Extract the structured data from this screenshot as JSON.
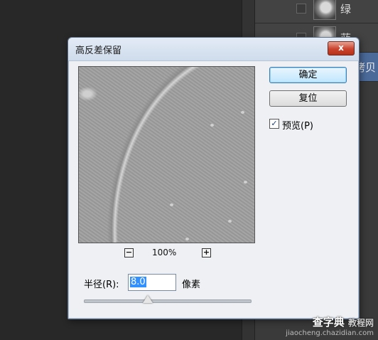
{
  "layers_panel": {
    "layers": [
      {
        "name": "绿",
        "selected": false
      },
      {
        "name": "蓝",
        "selected": false
      },
      {
        "name": "拷贝",
        "selected": true
      }
    ]
  },
  "dialog": {
    "title": "高反差保留",
    "close_label": "x",
    "ok_label": "确定",
    "reset_label": "复位",
    "preview_checkbox": {
      "label": "预览(P)",
      "checked": true
    },
    "zoom": {
      "minus": "−",
      "plus": "+",
      "value": "100%"
    },
    "radius": {
      "label": "半径(R):",
      "value": "8.0",
      "unit": "像素",
      "slider_fraction": 0.38
    }
  },
  "watermark": {
    "main": "查字典",
    "sub": "教程网",
    "url": "jiaocheng.chazidian.com"
  },
  "colors": {
    "accent": "#3390ff",
    "selected_layer": "#4b6a9a",
    "close_button": "#c9432d"
  }
}
